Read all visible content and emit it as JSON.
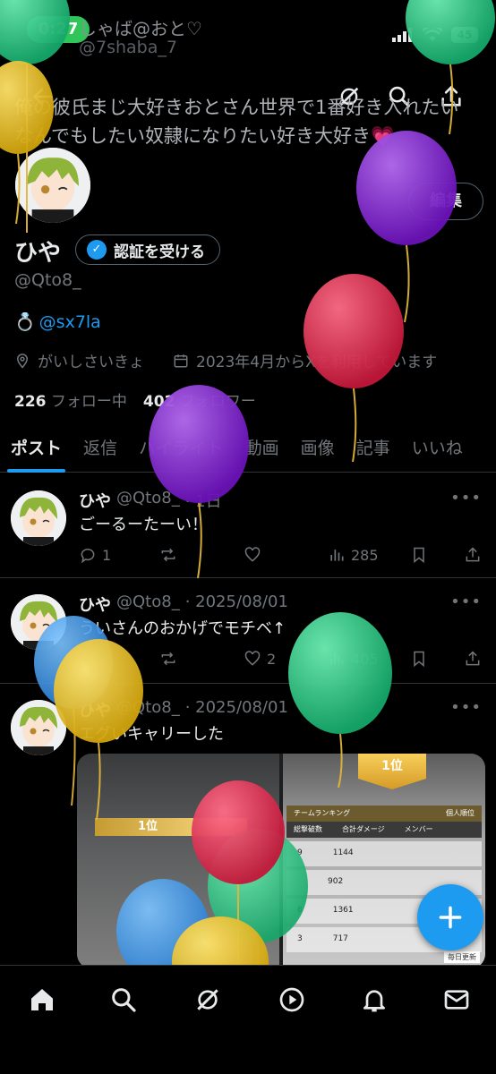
{
  "status_bar": {
    "time": "0:27",
    "battery": "45"
  },
  "header": {
    "name": "しゃば@おと♡",
    "handle": "@7shaba_7",
    "bio_line1": "俺の彼氏まじ大好きおとさん世界で1番好き入れたい",
    "bio_line2": "なんでもしたい奴隷になりたい好き大好き💗",
    "icons": [
      "back-arrow-icon",
      "grok-icon",
      "search-icon",
      "share-icon"
    ]
  },
  "profile": {
    "edit_label": "編集",
    "display_name": "ひや",
    "verify_label": "認証を受ける",
    "handle": "@Qto8_",
    "ring_emoji": "💍",
    "ring_link": "@sx7la",
    "location": "がいしさいきょ",
    "joined": "2023年4月からXを利用しています",
    "following_count": "226",
    "following_label": "フォロー中",
    "followers_count": "402",
    "followers_label": "フォロワー"
  },
  "tabs": [
    "ポスト",
    "返信",
    "ハイライト",
    "動画",
    "画像",
    "記事",
    "いいね"
  ],
  "posts": [
    {
      "name": "ひや",
      "handle": "@Qto8_",
      "date": "· 1日",
      "text": "ごーるーたーい！",
      "replies": "1",
      "reposts": "",
      "likes": "",
      "views": "285"
    },
    {
      "name": "ひや",
      "handle": "@Qto8_",
      "date": "· 2025/08/01",
      "text": "ういさんのおかげでモチベ↑",
      "replies": "",
      "reposts": "",
      "likes": "2",
      "views": "405"
    },
    {
      "name": "ひや",
      "handle": "@Qto8_",
      "date": "· 2025/08/01",
      "text": "エグいキャリーした",
      "replies": "",
      "reposts": "",
      "likes": "",
      "views": ""
    }
  ],
  "media": {
    "left_rank": "1位",
    "right_rank": "1位",
    "left_tabs": [
      "チームランキング",
      "個人順位"
    ],
    "right_headers": [
      "総撃破数",
      "合計ダメージ",
      "メンバー"
    ],
    "right_rows": [
      [
        "9",
        "1144"
      ],
      [
        "",
        "902"
      ],
      [
        "8",
        "1361"
      ],
      [
        "3",
        "717"
      ]
    ],
    "right_footer": "毎日更新"
  },
  "bottom_nav": [
    "home-icon",
    "search-icon",
    "grok-icon",
    "video-icon",
    "notifications-icon",
    "messages-icon"
  ],
  "colors": {
    "accent": "#1d9bf0",
    "background": "#000000",
    "muted": "#71767b"
  }
}
